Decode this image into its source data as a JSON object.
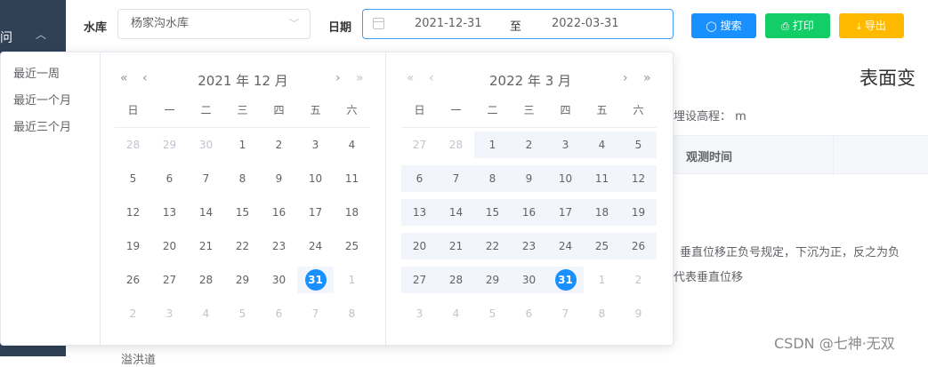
{
  "sidebar": {
    "partial_label": "问"
  },
  "toolbar": {
    "reservoir_label": "水库",
    "reservoir_value": "杨家沟水库",
    "date_label": "日期",
    "start_date": "2021-12-31",
    "range_separator": "至",
    "end_date": "2022-03-31",
    "search_label": "搜索",
    "print_label": "打印",
    "export_label": "导出"
  },
  "page": {
    "title_partial": "表面变",
    "elevation_label_partial": "埋设高程： m",
    "column_observe_time": "观测时间",
    "note_line1": "垂直位移正负号规定，下沉为正，反之为负",
    "note_line2": "代表垂直位移",
    "bottom_partial": "溢洪道",
    "watermark": "CSDN @七神·无双"
  },
  "picker": {
    "shortcuts": [
      "最近一周",
      "最近一个月",
      "最近三个月"
    ],
    "weekdays": [
      "日",
      "一",
      "二",
      "三",
      "四",
      "五",
      "六"
    ],
    "left": {
      "title": "2021 年 12 月",
      "days": [
        "28",
        "29",
        "30",
        "1",
        "2",
        "3",
        "4",
        "5",
        "6",
        "7",
        "8",
        "9",
        "10",
        "11",
        "12",
        "13",
        "14",
        "15",
        "16",
        "17",
        "18",
        "19",
        "20",
        "21",
        "22",
        "23",
        "24",
        "25",
        "26",
        "27",
        "28",
        "29",
        "30",
        "31",
        "1",
        "2",
        "3",
        "4",
        "5",
        "6",
        "7",
        "8"
      ],
      "first_current": 3,
      "last_current": 33,
      "range_start": 33,
      "range_end": 33,
      "selected": 33
    },
    "right": {
      "title": "2022 年 3 月",
      "days": [
        "27",
        "28",
        "1",
        "2",
        "3",
        "4",
        "5",
        "6",
        "7",
        "8",
        "9",
        "10",
        "11",
        "12",
        "13",
        "14",
        "15",
        "16",
        "17",
        "18",
        "19",
        "20",
        "21",
        "22",
        "23",
        "24",
        "25",
        "26",
        "27",
        "28",
        "29",
        "30",
        "31",
        "1",
        "2",
        "3",
        "4",
        "5",
        "6",
        "7",
        "8",
        "9"
      ],
      "first_current": 2,
      "last_current": 32,
      "range_start": 2,
      "range_end": 32,
      "selected": 32
    }
  },
  "colors": {
    "primary": "#1890ff",
    "success": "#13ce66",
    "warning": "#ffba00",
    "sidebar": "#304156",
    "range_bg": "#f2f6fc"
  }
}
